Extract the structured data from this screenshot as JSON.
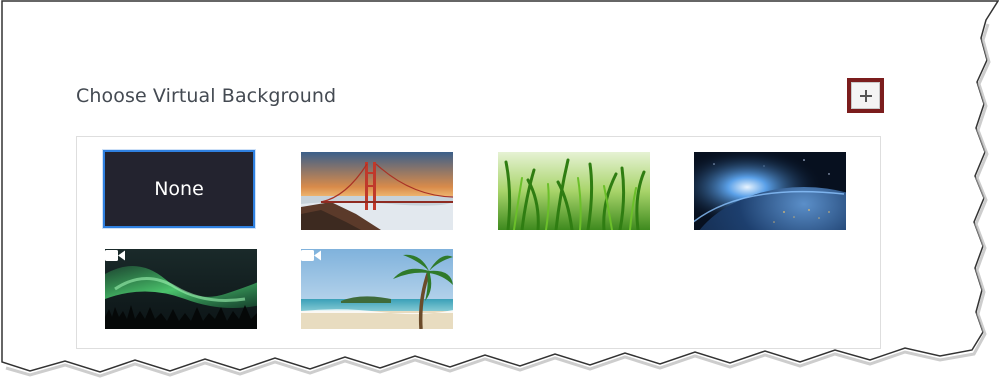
{
  "dialog": {
    "title": "Choose Virtual Background",
    "add_icon": "plus-icon"
  },
  "backgrounds": [
    {
      "id": "none",
      "label": "None",
      "selected": true,
      "video": false
    },
    {
      "id": "golden-gate",
      "label": "",
      "selected": false,
      "video": false
    },
    {
      "id": "grass",
      "label": "",
      "selected": false,
      "video": false
    },
    {
      "id": "earth",
      "label": "",
      "selected": false,
      "video": false
    },
    {
      "id": "aurora",
      "label": "",
      "selected": false,
      "video": true
    },
    {
      "id": "beach",
      "label": "",
      "selected": false,
      "video": true
    }
  ],
  "colors": {
    "accent": "#2f80e0",
    "add_button_frame": "#7b1d1d",
    "none_tile": "#23232f"
  }
}
